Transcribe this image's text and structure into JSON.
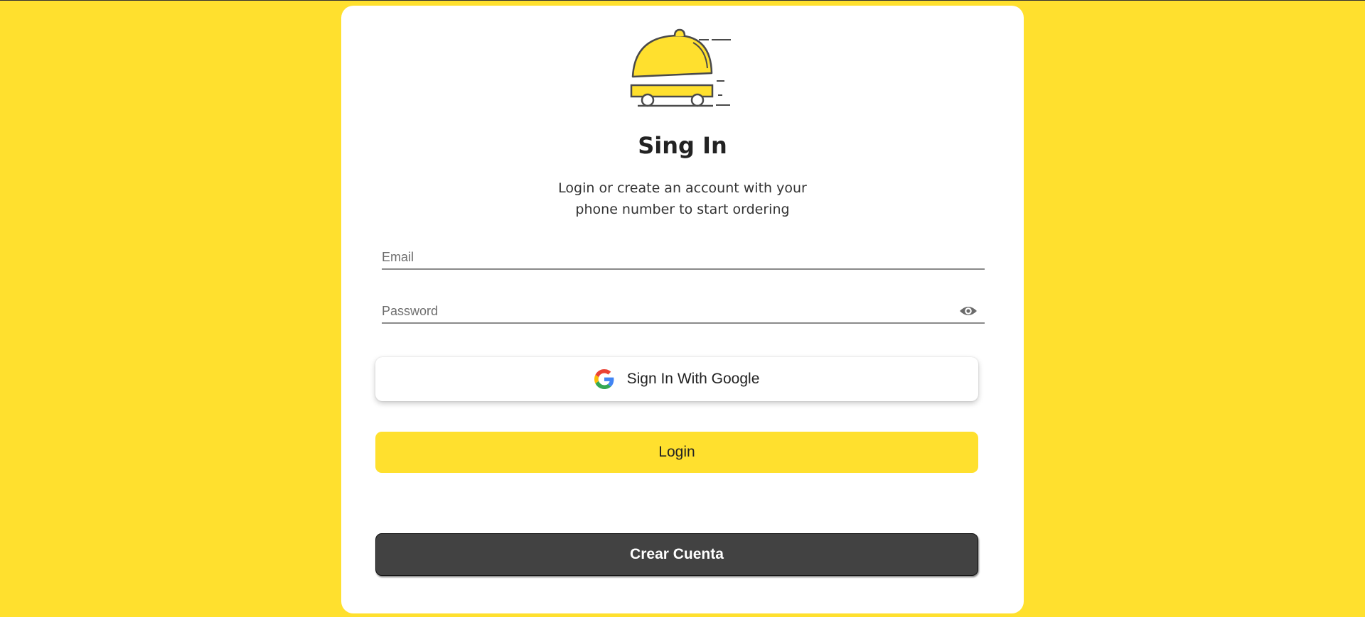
{
  "app": {
    "title": "Sing In",
    "subtitle": "Login or create an account with your phone number to start ordering"
  },
  "form": {
    "email": {
      "placeholder": "Email",
      "value": ""
    },
    "password": {
      "placeholder": "Password",
      "value": ""
    }
  },
  "buttons": {
    "google_label": "Sign In With Google",
    "login_label": "Login",
    "create_label": "Crear Cuenta"
  },
  "icons": {
    "logo": "delivery-cloche-cart-icon",
    "eye": "eye-icon",
    "google": "google-g-icon"
  },
  "colors": {
    "background": "#FFE02E",
    "card": "#FFFFFF",
    "accent": "#FFE02E",
    "dark_button": "#424242"
  }
}
